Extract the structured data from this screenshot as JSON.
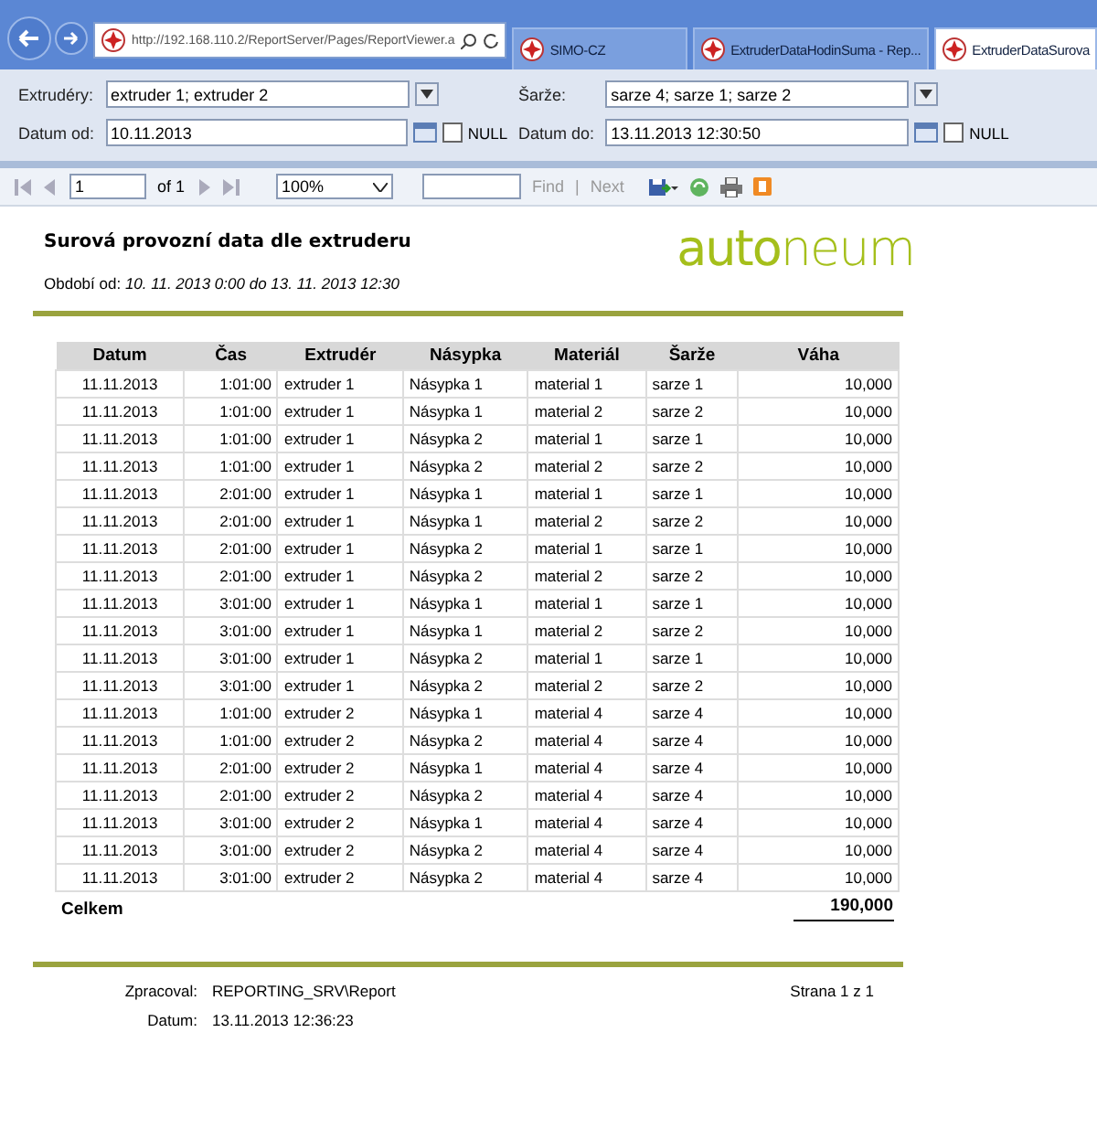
{
  "browser": {
    "address": "http://192.168.110.2/ReportServer/Pages/ReportViewer.a",
    "tabs": [
      {
        "label": "SIMO-CZ",
        "selected": false
      },
      {
        "label": "ExtruderDataHodinSuma - Rep...",
        "selected": false
      },
      {
        "label": "ExtruderDataSurova",
        "selected": true
      }
    ]
  },
  "parameters": [
    {
      "label": "Extrudéry:",
      "value": "extruder 1; extruder 2",
      "kind": "dropdown"
    },
    {
      "label": "Šarže:",
      "value": "sarze 4; sarze 1; sarze 2",
      "kind": "dropdown"
    },
    {
      "label": "Datum od:",
      "value": "10.11.2013",
      "kind": "date",
      "null_label": "NULL",
      "null_checked": false
    },
    {
      "label": "Datum do:",
      "value": "13.11.2013 12:30:50",
      "kind": "date",
      "null_label": "NULL",
      "null_checked": false
    }
  ],
  "toolbar": {
    "page": "1",
    "page_count": "of 1",
    "zoom": "100%",
    "find": "Find",
    "separator": "|",
    "next": "Next"
  },
  "report": {
    "title": "Surová provozní data dle extruderu",
    "logo": "**auto**neum",
    "period_label": "Období od:",
    "period": "10. 11. 2013 0:00 do 13. 11. 2013 12:30",
    "table": {
      "columns": [
        "Datum",
        "Čas",
        "Extrudér",
        "Násypka",
        "Materiál",
        "Šarže",
        "Váha"
      ],
      "rows": [
        [
          "11.11.2013",
          "1:01:00",
          "extruder 1",
          "Násypka 1",
          "material 1",
          "sarze 1",
          "10,000"
        ],
        [
          "11.11.2013",
          "1:01:00",
          "extruder 1",
          "Násypka 1",
          "material 2",
          "sarze 2",
          "10,000"
        ],
        [
          "11.11.2013",
          "1:01:00",
          "extruder 1",
          "Násypka 2",
          "material 1",
          "sarze 1",
          "10,000"
        ],
        [
          "11.11.2013",
          "1:01:00",
          "extruder 1",
          "Násypka 2",
          "material 2",
          "sarze 2",
          "10,000"
        ],
        [
          "11.11.2013",
          "2:01:00",
          "extruder 1",
          "Násypka 1",
          "material 1",
          "sarze 1",
          "10,000"
        ],
        [
          "11.11.2013",
          "2:01:00",
          "extruder 1",
          "Násypka 1",
          "material 2",
          "sarze 2",
          "10,000"
        ],
        [
          "11.11.2013",
          "2:01:00",
          "extruder 1",
          "Násypka 2",
          "material 1",
          "sarze 1",
          "10,000"
        ],
        [
          "11.11.2013",
          "2:01:00",
          "extruder 1",
          "Násypka 2",
          "material 2",
          "sarze 2",
          "10,000"
        ],
        [
          "11.11.2013",
          "3:01:00",
          "extruder 1",
          "Násypka 1",
          "material 1",
          "sarze 1",
          "10,000"
        ],
        [
          "11.11.2013",
          "3:01:00",
          "extruder 1",
          "Násypka 1",
          "material 2",
          "sarze 2",
          "10,000"
        ],
        [
          "11.11.2013",
          "3:01:00",
          "extruder 1",
          "Násypka 2",
          "material 1",
          "sarze 1",
          "10,000"
        ],
        [
          "11.11.2013",
          "3:01:00",
          "extruder 1",
          "Násypka 2",
          "material 2",
          "sarze 2",
          "10,000"
        ],
        [
          "11.11.2013",
          "1:01:00",
          "extruder 2",
          "Násypka 1",
          "material 4",
          "sarze 4",
          "10,000"
        ],
        [
          "11.11.2013",
          "1:01:00",
          "extruder 2",
          "Násypka 2",
          "material 4",
          "sarze 4",
          "10,000"
        ],
        [
          "11.11.2013",
          "2:01:00",
          "extruder 2",
          "Násypka 1",
          "material 4",
          "sarze 4",
          "10,000"
        ],
        [
          "11.11.2013",
          "2:01:00",
          "extruder 2",
          "Násypka 2",
          "material 4",
          "sarze 4",
          "10,000"
        ],
        [
          "11.11.2013",
          "3:01:00",
          "extruder 2",
          "Násypka 1",
          "material 4",
          "sarze 4",
          "10,000"
        ],
        [
          "11.11.2013",
          "3:01:00",
          "extruder 2",
          "Násypka 2",
          "material 4",
          "sarze 4",
          "10,000"
        ],
        [
          "11.11.2013",
          "3:01:00",
          "extruder 2",
          "Násypka 2",
          "material 4",
          "sarze 4",
          "10,000"
        ]
      ],
      "total_label": "Celkem",
      "total": "190,000"
    },
    "footer": {
      "processed_label": "Zpracoval:",
      "processed": "REPORTING_SRV\\Report",
      "page": "Strana 1 z 1",
      "date_label": "Datum:",
      "date": "13.11.2013 12:36:23"
    }
  }
}
